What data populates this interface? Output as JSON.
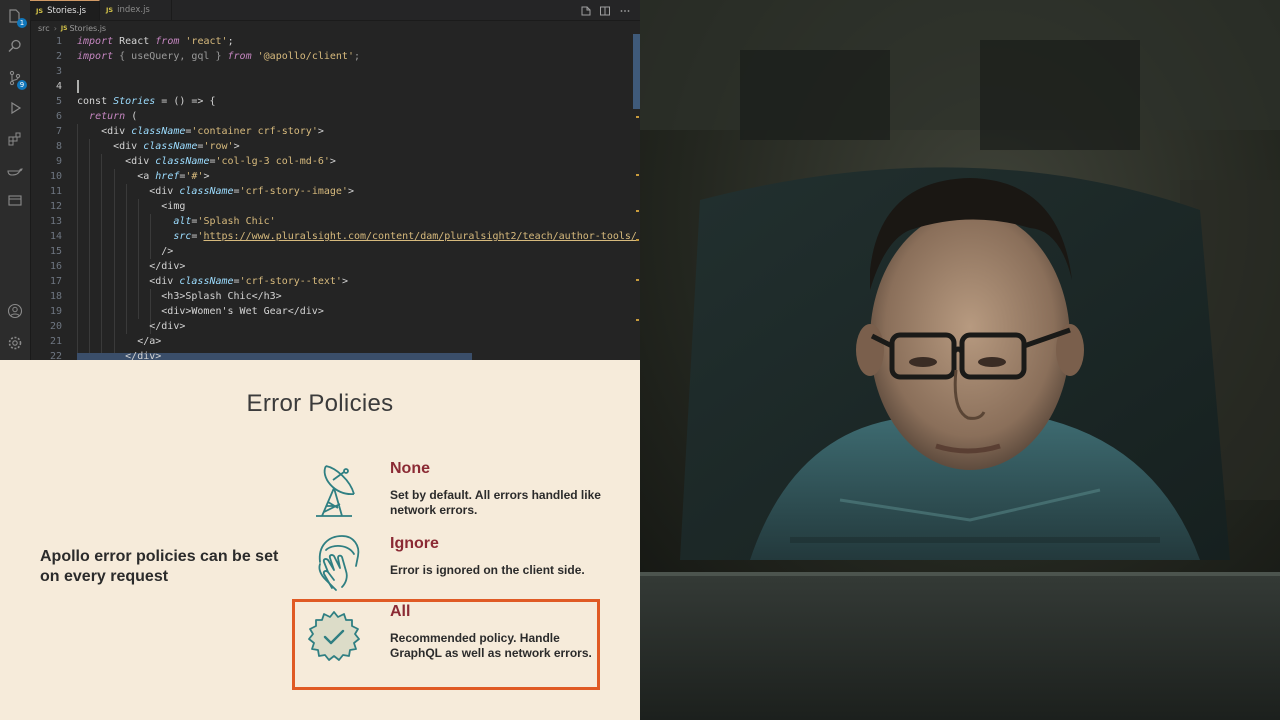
{
  "editor": {
    "tabs": [
      {
        "label": "Stories.js",
        "icon": "JS",
        "active": true,
        "modified": true
      },
      {
        "label": "index.js",
        "icon": "JS",
        "active": false,
        "modified": false
      }
    ],
    "breadcrumb": [
      "src",
      "Stories.js"
    ],
    "breadcrumb_icon": "JS",
    "activity_badges": {
      "explorer": "1",
      "source_control": "9"
    },
    "cursor_line": 4,
    "code_lines": [
      {
        "n": "1",
        "html": "<span class='kw-i'>import</span> React <span class='kw-i'>from</span> <span class='str'>'react'</span>;"
      },
      {
        "n": "2",
        "html": "<span style='color:#9a9a9a'><span class='kw-i'>import</span> { useQuery, gql } <span class='kw-i'>from</span> <span class='str'>'@apollo/client'</span>;</span>"
      },
      {
        "n": "3",
        "html": ""
      },
      {
        "n": "4",
        "html": ""
      },
      {
        "n": "5",
        "html": "const <span class='comp'>Stories</span> = () =&gt; {"
      },
      {
        "n": "6",
        "html": "  <span class='kw-i'>return</span> ("
      },
      {
        "n": "7",
        "html": "    &lt;div <span class='attr'>className</span>=<span class='str'>'container crf-story'</span>&gt;"
      },
      {
        "n": "8",
        "html": "      &lt;div <span class='attr'>className</span>=<span class='str'>'row'</span>&gt;"
      },
      {
        "n": "9",
        "html": "        &lt;div <span class='attr'>className</span>=<span class='str'>'col-lg-3 col-md-6'</span>&gt;"
      },
      {
        "n": "10",
        "html": "          &lt;a <span class='attr'>href</span>=<span class='str'>'#'</span>&gt;"
      },
      {
        "n": "11",
        "html": "            &lt;div <span class='attr'>className</span>=<span class='str'>'crf-story--image'</span>&gt;"
      },
      {
        "n": "12",
        "html": "              &lt;img"
      },
      {
        "n": "13",
        "html": "                <span class='attr'>alt</span>=<span class='str'>'Splash Chic'</span>"
      },
      {
        "n": "14",
        "html": "                <span class='attr'>src</span>=<span class='str'>'</span><span class='url'>https://www.pluralsight.com/content/dam/pluralsight2/teach/author-tools/</span>"
      },
      {
        "n": "15",
        "html": "              /&gt;"
      },
      {
        "n": "16",
        "html": "            &lt;/div&gt;"
      },
      {
        "n": "17",
        "html": "            &lt;div <span class='attr'>className</span>=<span class='str'>'crf-story--text'</span>&gt;"
      },
      {
        "n": "18",
        "html": "              &lt;h3&gt;Splash Chic&lt;/h3&gt;"
      },
      {
        "n": "19",
        "html": "              &lt;div&gt;Women's Wet Gear&lt;/div&gt;"
      },
      {
        "n": "20",
        "html": "            &lt;/div&gt;"
      },
      {
        "n": "21",
        "html": "          &lt;/a&gt;"
      },
      {
        "n": "22",
        "html": "        &lt;/div&gt;"
      }
    ]
  },
  "slide": {
    "title": "Error Policies",
    "intro": "Apollo error policies can be set on every request",
    "policies": [
      {
        "name": "None",
        "description": "Set by default. All errors handled like network errors.",
        "icon": "satellite-dish-icon"
      },
      {
        "name": "Ignore",
        "description": "Error is ignored on the client side.",
        "icon": "face-palm-icon"
      },
      {
        "name": "All",
        "description": "Recommended policy. Handle GraphQL as well as network errors.",
        "icon": "check-badge-icon",
        "highlighted": true
      }
    ],
    "highlight_color": "#e05a24",
    "name_color": "#8b2a34"
  },
  "photo": {
    "subject": "presenter-at-desk"
  }
}
